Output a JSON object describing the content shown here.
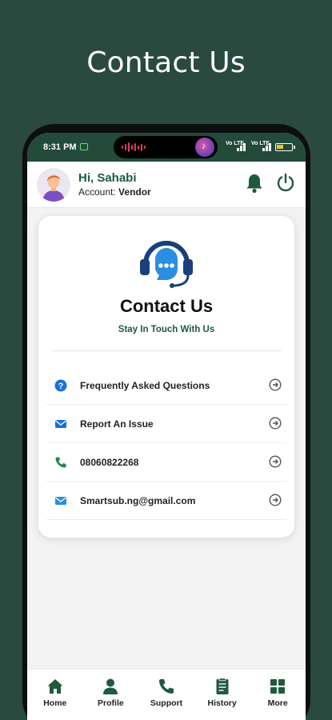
{
  "promo": {
    "title": "Contact Us"
  },
  "status_bar": {
    "time": "8:31 PM",
    "signal_1": "Vo LTE",
    "signal_2": "Vo LTE"
  },
  "header": {
    "greeting": "Hi, Sahabi",
    "account_label": "Account:",
    "account_type": "Vendor"
  },
  "card": {
    "title": "Contact Us",
    "subtitle": "Stay In Touch With Us",
    "items": [
      {
        "label": "Frequently Asked Questions",
        "icon": "question-icon"
      },
      {
        "label": "Report An Issue",
        "icon": "envelope-icon"
      },
      {
        "label": "08060822268",
        "icon": "phone-icon"
      },
      {
        "label": "Smartsub.ng@gmail.com",
        "icon": "mail-icon"
      }
    ]
  },
  "bottom_nav": [
    {
      "label": "Home",
      "icon": "home-icon"
    },
    {
      "label": "Profile",
      "icon": "profile-icon"
    },
    {
      "label": "Support",
      "icon": "phone-icon"
    },
    {
      "label": "History",
      "icon": "history-icon"
    },
    {
      "label": "More",
      "icon": "grid-icon"
    }
  ],
  "colors": {
    "background": "#2a4a40",
    "brand_green": "#1f5a3f",
    "accent_blue": "#1e6fd9",
    "phone_green": "#1e8a4c"
  }
}
